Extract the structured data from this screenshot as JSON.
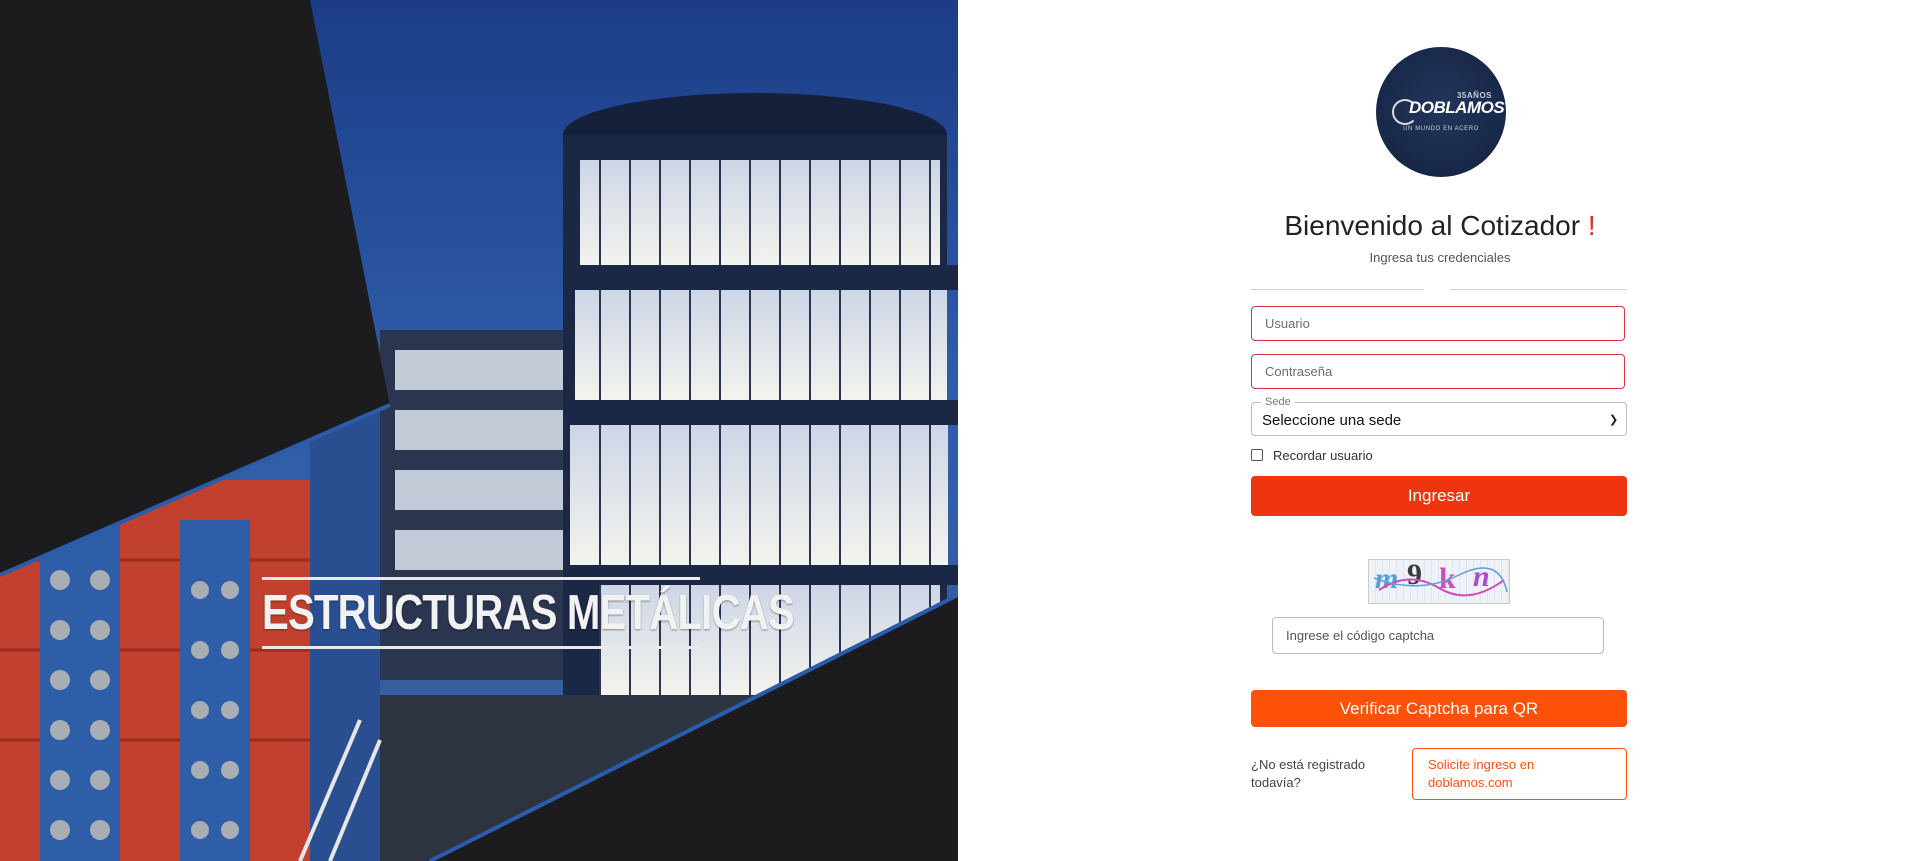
{
  "hero": {
    "caption": "ESTRUCTURAS METÁLICAS"
  },
  "logo": {
    "years": "35AÑOS",
    "brand": "DOBLAMOS",
    "tagline": "UN MUNDO EN ACERO"
  },
  "login": {
    "title": "Bienvenido al Cotizador",
    "title_mark": "!",
    "subtitle": "Ingresa tus credenciales",
    "username_placeholder": "Usuario",
    "password_placeholder": "Contraseña",
    "sede_label": "Sede",
    "sede_selected": "Seleccione una sede",
    "remember_label": "Recordar usuario",
    "submit_label": "Ingresar"
  },
  "captcha": {
    "code_chars": [
      "m",
      "9",
      "k",
      "n"
    ],
    "input_placeholder": "Ingrese el código captcha",
    "verify_label": "Verificar Captcha para QR"
  },
  "register": {
    "prompt": "¿No está registrado todavía?",
    "link_label": "Solicite ingreso en doblamos.com"
  },
  "colors": {
    "primary_button": "#ee3510",
    "secondary_button": "#fe5108",
    "error_border": "#dc3545",
    "logo_bg": "#172748"
  }
}
